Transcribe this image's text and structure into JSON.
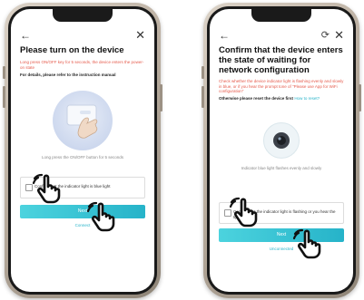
{
  "left_screen": {
    "title": "Please turn on the device",
    "red_note": "Long press ON/OFF key for 5 seconds, the device enters the power-on state",
    "detail_text": "For details, please refer to the instruction manual",
    "illustration_caption": "Long press the ON/OFF button for 5 seconds",
    "checkbox_label": "Confirm that the indicator light is blue light",
    "next_button": "Next",
    "sub_link": "Connect"
  },
  "right_screen": {
    "title": "Confirm that the device enters the state of waiting for network configuration",
    "red_note": "Check whether the device indicator light is flashing evenly and slowly in blue, or if you hear the prompt tone of \"Please use App for WiFi configuration\"",
    "reset_prompt": "Otherwise please reset the device first",
    "reset_link": "How to reset?",
    "illustration_caption": "Indicator blue light flashes evenly and slowly",
    "checkbox_label": "Confirm that the indicator light is flashing or you hear the tip",
    "next_button": "Next",
    "sub_link": "Unconnected"
  },
  "icons": {
    "back": "←",
    "refresh": "⟳",
    "close": "✕"
  },
  "colors": {
    "accent": "#26b3c9",
    "warning_text": "#e55a4b",
    "phone_frame": "#b9ad9f"
  }
}
